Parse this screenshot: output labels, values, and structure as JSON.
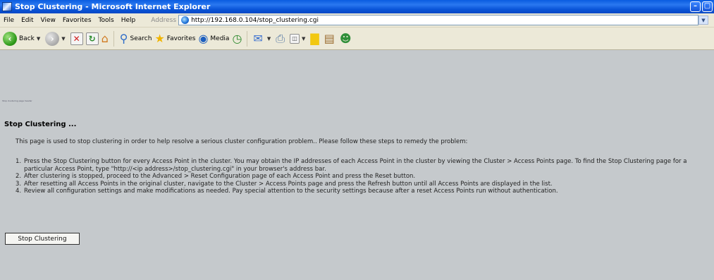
{
  "window": {
    "title": "Stop Clustering - Microsoft Internet Explorer",
    "minimize": "–",
    "maximize": "▢"
  },
  "menu": {
    "items": [
      "File",
      "Edit",
      "View",
      "Favorites",
      "Tools",
      "Help"
    ],
    "address_label": "Address",
    "address_value": "http://192.168.0.104/stop_clustering.cgi"
  },
  "toolbar": {
    "back_label": "Back",
    "search_label": "Search",
    "favorites_label": "Favorites",
    "media_label": "Media"
  },
  "page": {
    "tiny_text": "Stop clustering page header",
    "title": "Stop Clustering ...",
    "intro": "This page is used to stop clustering in order to help resolve a serious cluster configuration problem.. Please follow these steps to remedy the problem:",
    "steps": [
      {
        "num": "1.",
        "text": "Press the Stop Clustering button for every Access Point in the cluster.  You may obtain the IP addresses of each Access Point in the cluster by viewing the Cluster > Access Points page.  To find the Stop Clustering page for a particular Access Point, type \"http://<ip address>/stop_clustering.cgi\" in your browser's address bar."
      },
      {
        "num": "2.",
        "text": "After clustering is stopped, proceed to the Advanced > Reset Configuration page of each Access Point and press the Reset button."
      },
      {
        "num": "3.",
        "text": "After resetting all Access Points in the original cluster, navigate to the Cluster > Access Points page and press the Refresh button until all Access Points are displayed in the list."
      },
      {
        "num": "4.",
        "text": "Review all configuration settings and make modifications as needed. Pay special attention to the security settings because after a reset Access Points run without authentication."
      }
    ],
    "button_label": "Stop Clustering"
  }
}
